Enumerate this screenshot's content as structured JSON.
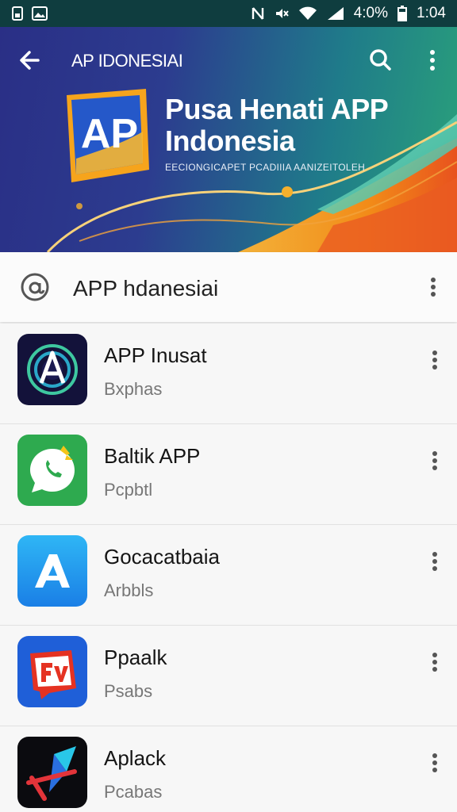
{
  "status_bar": {
    "battery_text": "4:0%",
    "time": "1:04"
  },
  "toolbar": {
    "title": "AP IDONESIAI"
  },
  "banner": {
    "logo_text": "AP",
    "title_line1": "Pusa Henati APP",
    "title_line2": "Indonesia",
    "subtitle": "EECIONGICAPET PCADIIIA AANIZEITOLEH"
  },
  "section": {
    "title": "APP hdanesiai"
  },
  "apps": [
    {
      "name": "APP Inusat",
      "subtitle": "Bxphas"
    },
    {
      "name": "Baltik APP",
      "subtitle": "Pcpbtl"
    },
    {
      "name": "Gocacatbaia",
      "subtitle": "Arbbls"
    },
    {
      "name": "Ppaalk",
      "subtitle": "Psabs"
    },
    {
      "name": "Aplack",
      "subtitle": "Pcabas"
    }
  ],
  "colors": {
    "accent_orange": "#f28b18",
    "banner_blue": "#2a2f86",
    "banner_teal": "#1f7b8a"
  }
}
